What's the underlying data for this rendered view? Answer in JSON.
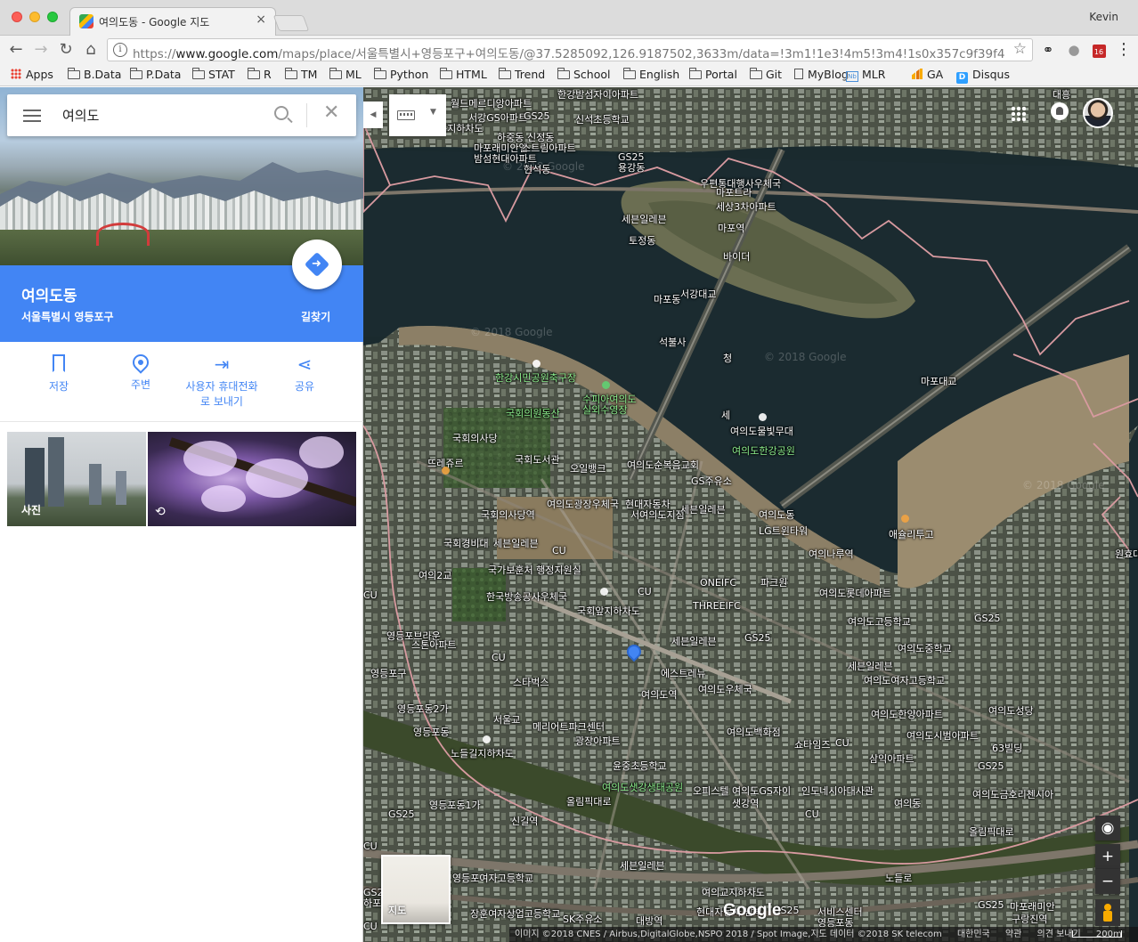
{
  "browser": {
    "tab_title": "여의도동 - Google 지도",
    "tab_close": "×",
    "profile_name": "Kevin",
    "url_scheme": "https://",
    "url_host": "www.google.com",
    "url_rest": "/maps/place/서울특별시+영등포구+여의도동/@37.5285092,126.9187502,3633m/data=!3m1!1e3!4m5!3m4!1s0x357c9f39f4ec04d...",
    "nav": {
      "back": "←",
      "forward": "→",
      "reload": "↻",
      "home": "⌂"
    },
    "omni_info": "i",
    "omni_star": "☆",
    "extension_icons": [
      "link-extension-icon",
      "incognito-extension-icon",
      "calendar-extension-icon",
      "menu-dots-icon"
    ],
    "calendar_badge": "16",
    "menu": "⋮",
    "bookmarks": [
      {
        "label": "Apps",
        "icon": "apps"
      },
      {
        "label": "B.Data",
        "icon": "folder"
      },
      {
        "label": "P.Data",
        "icon": "folder"
      },
      {
        "label": "STAT",
        "icon": "folder"
      },
      {
        "label": "R",
        "icon": "folder"
      },
      {
        "label": "TM",
        "icon": "folder"
      },
      {
        "label": "ML",
        "icon": "folder"
      },
      {
        "label": "Python",
        "icon": "folder"
      },
      {
        "label": "HTML",
        "icon": "folder"
      },
      {
        "label": "Trend",
        "icon": "folder"
      },
      {
        "label": "School",
        "icon": "folder"
      },
      {
        "label": "English",
        "icon": "folder"
      },
      {
        "label": "Portal",
        "icon": "folder"
      },
      {
        "label": "Git",
        "icon": "folder"
      },
      {
        "label": "MyBlog",
        "icon": "doc"
      },
      {
        "label": "MLR",
        "icon": "nb"
      },
      {
        "label": "GA",
        "icon": "ga"
      },
      {
        "label": "Disqus",
        "icon": "disqus"
      }
    ],
    "nb_glyph": "Nb",
    "disqus_glyph": "D"
  },
  "search": {
    "query": "여의도",
    "clear": "✕"
  },
  "place": {
    "title": "여의도동",
    "subtitle": "서울특별시 영등포구",
    "directions_label": "길찾기",
    "directions_arrow": "➜"
  },
  "actions": [
    {
      "label": "저장",
      "icon": "bookmark-icon"
    },
    {
      "label": "주변",
      "icon": "nearby-pin-icon"
    },
    {
      "label": "사용자 휴대전화\n로 보내기",
      "icon": "send-to-phone-icon",
      "line1": "사용자 휴대전화",
      "line2": "로 보내기",
      "glyph": "⇥"
    },
    {
      "label": "공유",
      "icon": "share-icon",
      "glyph": "⋖"
    }
  ],
  "photos": {
    "label": "사진",
    "pano_icon": "⟲"
  },
  "map": {
    "collapse_arrow": "◀",
    "kbd_caret": "▼",
    "mode_label": "지도",
    "google_logo": "Google",
    "zoom_in": "+",
    "zoom_out": "−",
    "compass": "◉",
    "attribution": [
      "이미지 ©2018 CNES / Airbus,DigitalGlobe,NSPO 2018 / Spot Image,지도 데이터 ©2018 SK telecom",
      "대한민국",
      "약관",
      "의견 보내기",
      "200m"
    ],
    "watermark": "© 2018 Google",
    "labels": [
      {
        "text": "당인동",
        "kind": "normal"
      },
      {
        "text": "월드메르디앙아파트",
        "kind": "normal"
      },
      {
        "text": "한강밤섬자이아파트",
        "kind": "normal"
      },
      {
        "text": "서강GS아파트",
        "kind": "normal"
      },
      {
        "text": "GS25",
        "kind": "normal"
      },
      {
        "text": "신석초등학교",
        "kind": "normal"
      },
      {
        "text": "동지하차도",
        "kind": "normal"
      },
      {
        "text": "하중동",
        "kind": "normal"
      },
      {
        "text": "신정동",
        "kind": "normal"
      },
      {
        "text": "마포래미안엘",
        "kind": "normal"
      },
      {
        "text": "스트림아파트",
        "kind": "normal"
      },
      {
        "text": "밤섬현대아파트",
        "kind": "normal"
      },
      {
        "text": "현석동",
        "kind": "normal"
      },
      {
        "text": "GS25",
        "kind": "normal"
      },
      {
        "text": "용강동",
        "kind": "normal"
      },
      {
        "text": "우편통대행사우체국",
        "kind": "normal"
      },
      {
        "text": "마포트라",
        "kind": "normal"
      },
      {
        "text": "세상3차아파트",
        "kind": "normal"
      },
      {
        "text": "세븐일레븐",
        "kind": "normal"
      },
      {
        "text": "마포역",
        "kind": "normal"
      },
      {
        "text": "토정동",
        "kind": "normal"
      },
      {
        "text": "바이더",
        "kind": "normal"
      },
      {
        "text": "서강대교",
        "kind": "bridge"
      },
      {
        "text": "마포동",
        "kind": "normal"
      },
      {
        "text": "석불사",
        "kind": "normal"
      },
      {
        "text": "청",
        "kind": "normal"
      },
      {
        "text": "마포대교",
        "kind": "bridge"
      },
      {
        "text": "세",
        "kind": "normal"
      },
      {
        "text": "한강시민공원축구장",
        "kind": "park"
      },
      {
        "text": "수피아여의도",
        "kind": "park"
      },
      {
        "text": "실외수영장",
        "kind": "park"
      },
      {
        "text": "국회의원동산",
        "kind": "park"
      },
      {
        "text": "국회의사당",
        "kind": "normal"
      },
      {
        "text": "여의도물빛무대",
        "kind": "normal"
      },
      {
        "text": "여의도한강공원",
        "kind": "park"
      },
      {
        "text": "국회도서관",
        "kind": "normal"
      },
      {
        "text": "오일뱅크",
        "kind": "normal"
      },
      {
        "text": "여의도순복음교회",
        "kind": "normal"
      },
      {
        "text": "GS주유소",
        "kind": "normal"
      },
      {
        "text": "뜨레쥬르",
        "kind": "normal"
      },
      {
        "text": "여의도광장우체국",
        "kind": "normal"
      },
      {
        "text": "현대자동차",
        "kind": "normal"
      },
      {
        "text": "서여의도지점",
        "kind": "normal"
      },
      {
        "text": "세븐일레븐",
        "kind": "normal"
      },
      {
        "text": "여의도동",
        "kind": "normal"
      },
      {
        "text": "국회의사당역",
        "kind": "normal"
      },
      {
        "text": "LG트윈타워",
        "kind": "normal"
      },
      {
        "text": "애슐리투고",
        "kind": "normal"
      },
      {
        "text": "국회경비대",
        "kind": "normal"
      },
      {
        "text": "세븐일레븐",
        "kind": "normal"
      },
      {
        "text": "CU",
        "kind": "normal"
      },
      {
        "text": "여의나루역",
        "kind": "normal"
      },
      {
        "text": "원효대",
        "kind": "normal"
      },
      {
        "text": "국가보훈처 행정지원실",
        "kind": "normal"
      },
      {
        "text": "여의2교",
        "kind": "normal"
      },
      {
        "text": "ONEIFC",
        "kind": "normal"
      },
      {
        "text": "파크원",
        "kind": "normal"
      },
      {
        "text": "한국방송공사우체국",
        "kind": "normal"
      },
      {
        "text": "CU",
        "kind": "normal"
      },
      {
        "text": "여의도롯데아파트",
        "kind": "normal"
      },
      {
        "text": "CU",
        "kind": "normal"
      },
      {
        "text": "국회앞지하차도",
        "kind": "normal"
      },
      {
        "text": "THREEIFC",
        "kind": "normal"
      },
      {
        "text": "여의도고등학교",
        "kind": "normal"
      },
      {
        "text": "GS25",
        "kind": "normal"
      },
      {
        "text": "영등포브라운",
        "kind": "normal"
      },
      {
        "text": "스톤아파트",
        "kind": "normal"
      },
      {
        "text": "세븐일레븐",
        "kind": "normal"
      },
      {
        "text": "GS25",
        "kind": "normal"
      },
      {
        "text": "여의도중학교",
        "kind": "normal"
      },
      {
        "text": "CU",
        "kind": "normal"
      },
      {
        "text": "에스트레뉴",
        "kind": "normal"
      },
      {
        "text": "세븐일레븐",
        "kind": "normal"
      },
      {
        "text": "영등포구",
        "kind": "normal"
      },
      {
        "text": "스타벅스",
        "kind": "normal"
      },
      {
        "text": "여의도역",
        "kind": "normal"
      },
      {
        "text": "여의도우체국",
        "kind": "normal"
      },
      {
        "text": "여의도여자고등학교",
        "kind": "normal"
      },
      {
        "text": "영등포동2가",
        "kind": "normal"
      },
      {
        "text": "여의도한양아파트",
        "kind": "normal"
      },
      {
        "text": "여의도성당",
        "kind": "normal"
      },
      {
        "text": "서울교",
        "kind": "normal"
      },
      {
        "text": "메리어트파크센터",
        "kind": "normal"
      },
      {
        "text": "영등포동",
        "kind": "normal"
      },
      {
        "text": "여의도백화점",
        "kind": "normal"
      },
      {
        "text": "광장아파트",
        "kind": "normal"
      },
      {
        "text": "여의도시범아파트",
        "kind": "normal"
      },
      {
        "text": "쇼타임즈",
        "kind": "normal"
      },
      {
        "text": "CU",
        "kind": "normal"
      },
      {
        "text": "63빌딩",
        "kind": "normal"
      },
      {
        "text": "노들길지하차도",
        "kind": "normal"
      },
      {
        "text": "삼익아파트",
        "kind": "normal"
      },
      {
        "text": "윤중초등학교",
        "kind": "normal"
      },
      {
        "text": "GS25",
        "kind": "normal"
      },
      {
        "text": "여의도샛강생태공원",
        "kind": "park"
      },
      {
        "text": "오피스텔 여의도GS자이",
        "kind": "normal"
      },
      {
        "text": "인도네시아대사관",
        "kind": "normal"
      },
      {
        "text": "여의도금호리첸시아",
        "kind": "normal"
      },
      {
        "text": "샛강역",
        "kind": "normal"
      },
      {
        "text": "올림픽대로",
        "kind": "normal"
      },
      {
        "text": "영등포동1가",
        "kind": "normal"
      },
      {
        "text": "CU",
        "kind": "normal"
      },
      {
        "text": "여의동",
        "kind": "normal"
      },
      {
        "text": "신길역",
        "kind": "normal"
      },
      {
        "text": "GS25",
        "kind": "normal"
      },
      {
        "text": "올림픽대로",
        "kind": "normal"
      },
      {
        "text": "세븐일레븐",
        "kind": "normal"
      },
      {
        "text": "노들로",
        "kind": "normal"
      },
      {
        "text": "영등포여자고등학교",
        "kind": "normal"
      },
      {
        "text": "여의교지하차도",
        "kind": "normal"
      },
      {
        "text": "장훈여자상업고등학교",
        "kind": "normal"
      },
      {
        "text": "GS25",
        "kind": "normal"
      },
      {
        "text": "SK주유소",
        "kind": "normal"
      },
      {
        "text": "대방역",
        "kind": "normal"
      },
      {
        "text": "현대자동차 남부",
        "kind": "normal"
      },
      {
        "text": "서비스센터",
        "kind": "normal"
      },
      {
        "text": "영등포동",
        "kind": "normal"
      },
      {
        "text": "CU",
        "kind": "normal"
      },
      {
        "text": "GS25",
        "kind": "normal"
      },
      {
        "text": "하포점",
        "kind": "normal"
      },
      {
        "text": "CU",
        "kind": "normal"
      },
      {
        "text": "GS25",
        "kind": "normal"
      },
      {
        "text": "구랑진역",
        "kind": "normal"
      },
      {
        "text": "마포래미안",
        "kind": "normal"
      },
      {
        "text": "대흥",
        "kind": "normal"
      }
    ]
  }
}
